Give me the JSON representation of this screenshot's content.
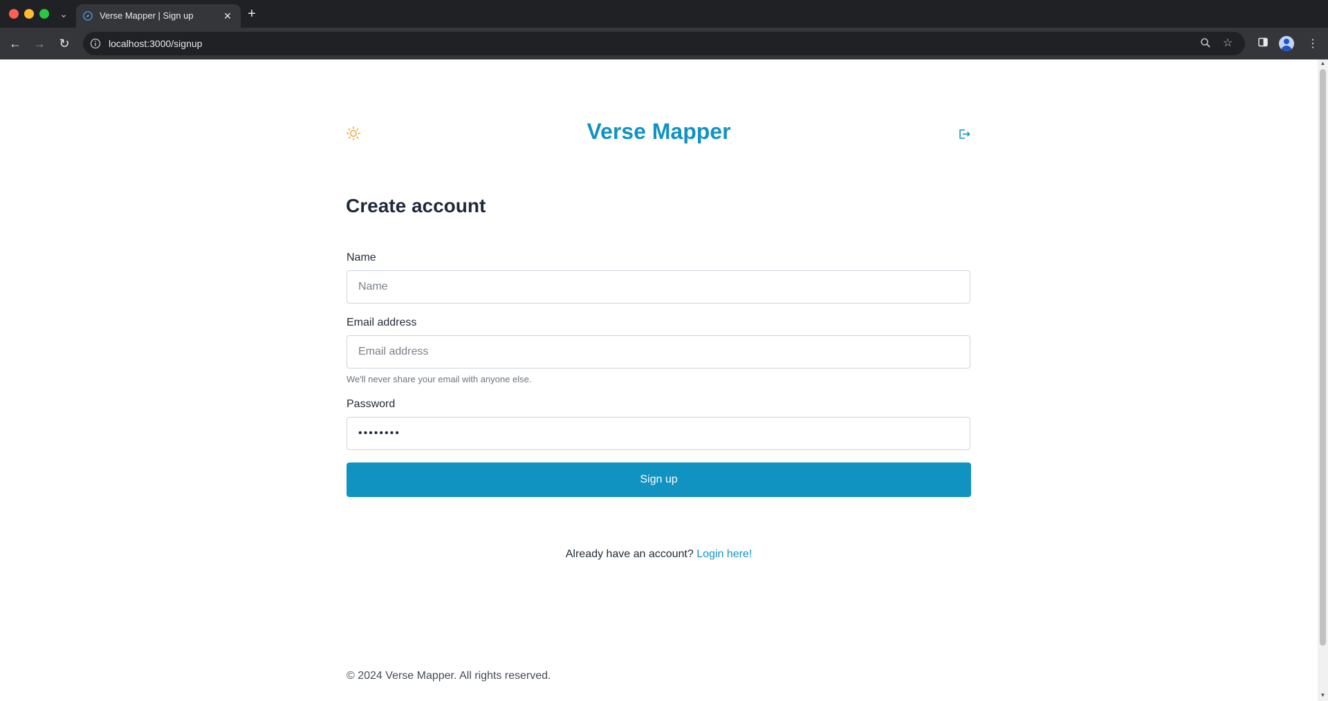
{
  "browser": {
    "tab_title": "Verse Mapper | Sign up",
    "url": "localhost:3000/signup",
    "icons": [
      "chevron-down-icon",
      "close-icon",
      "plus-icon",
      "back-arrow-icon",
      "forward-arrow-icon",
      "reload-icon",
      "info-icon",
      "zoom-icon",
      "star-icon",
      "side-panel-icon",
      "profile-icon",
      "kebab-menu-icon"
    ]
  },
  "header": {
    "brand": "Verse Mapper",
    "theme_icon": "sun-icon",
    "logout_icon": "logout-icon"
  },
  "form": {
    "title": "Create account",
    "name_label": "Name",
    "name_placeholder": "Name",
    "name_value": "",
    "email_label": "Email address",
    "email_placeholder": "Email address",
    "email_value": "",
    "email_help": "We'll never share your email with anyone else.",
    "password_label": "Password",
    "password_value": "••••••••",
    "submit_label": "Sign up"
  },
  "login": {
    "prompt": "Already have an account?",
    "link": "Login here!"
  },
  "footer": {
    "text": "© 2024 Verse Mapper. All rights reserved."
  },
  "colors": {
    "accent": "#1193c2",
    "sun": "#f4a534",
    "heading": "#1f2a37"
  }
}
